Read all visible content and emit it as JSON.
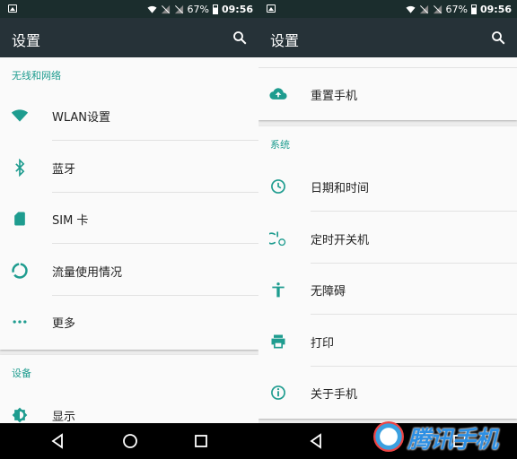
{
  "status": {
    "battery": "67%",
    "time": "09:56"
  },
  "left": {
    "title": "设置",
    "section_wireless": "无线和网络",
    "items": [
      {
        "label": "WLAN设置",
        "icon": "wifi-icon"
      },
      {
        "label": "蓝牙",
        "icon": "bluetooth-icon"
      },
      {
        "label": "SIM 卡",
        "icon": "sim-card-icon"
      },
      {
        "label": "流量使用情况",
        "icon": "data-usage-icon"
      },
      {
        "label": "更多",
        "icon": "more-horiz-icon"
      }
    ],
    "section_device": "设备",
    "device_items": [
      {
        "label": "显示",
        "icon": "brightness-icon"
      }
    ]
  },
  "right": {
    "title": "设置",
    "top_items": [
      {
        "label": "重置手机",
        "icon": "cloud-upload-icon"
      }
    ],
    "section_system": "系统",
    "items": [
      {
        "label": "日期和时间",
        "icon": "clock-icon"
      },
      {
        "label": "定时开关机",
        "icon": "power-schedule-icon"
      },
      {
        "label": "无障碍",
        "icon": "accessibility-icon"
      },
      {
        "label": "打印",
        "icon": "print-icon"
      },
      {
        "label": "关于手机",
        "icon": "info-icon"
      }
    ]
  },
  "watermark": {
    "text": "腾讯手机"
  },
  "colors": {
    "accent": "#1e9c8f",
    "toolbar": "#263238",
    "statusbar": "#1b2d2d"
  }
}
